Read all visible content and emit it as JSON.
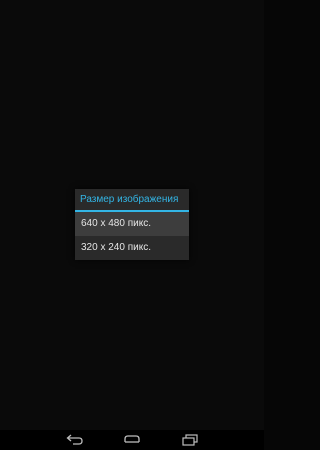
{
  "dialog": {
    "title": "Размер изображения",
    "accent_color": "#33b5e5",
    "options": [
      {
        "label": "640 x 480 пикс.",
        "selected": true
      },
      {
        "label": "320 x 240 пикс.",
        "selected": false
      }
    ]
  },
  "navbar": {
    "buttons": [
      "back-icon",
      "home-icon",
      "recent-apps-icon"
    ]
  }
}
